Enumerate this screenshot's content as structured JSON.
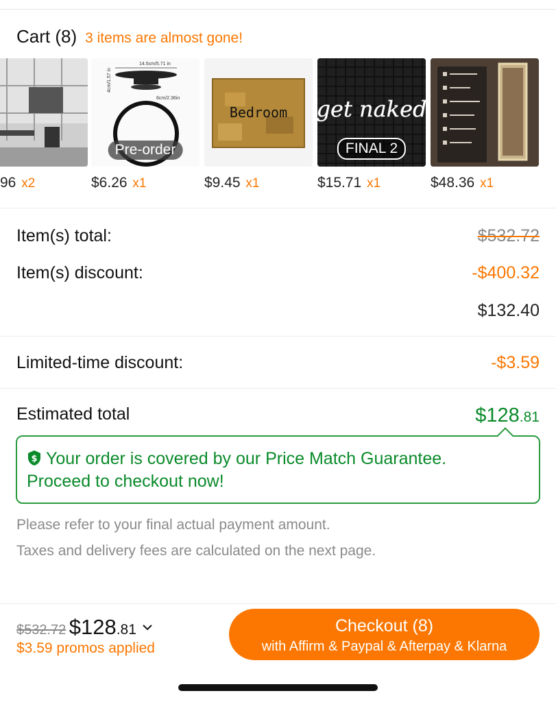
{
  "cart": {
    "title": "Cart (8)",
    "note": "3 items are almost gone!"
  },
  "items": [
    {
      "price": "96",
      "qty": "x2",
      "badge": ""
    },
    {
      "price": "$6.26",
      "qty": "x1",
      "badge": "Pre-order"
    },
    {
      "price": "$9.45",
      "qty": "x1",
      "badge": "",
      "sign_text": "Bedroom"
    },
    {
      "price": "$15.71",
      "qty": "x1",
      "badge": "FINAL 2",
      "neon_text": "get naked"
    },
    {
      "price": "$48.36",
      "qty": "x1",
      "badge": ""
    }
  ],
  "item2_dims": {
    "top": "14.5cm/5.71 in",
    "side": "4cm/1.57 in",
    "bottom": "6cm/2.36in"
  },
  "summary": {
    "items_total_label": "Item(s) total:",
    "items_total_value": "$532.72",
    "items_discount_label": "Item(s) discount:",
    "items_discount_value": "-$400.32",
    "subtotal_value": "$132.40",
    "limited_label": "Limited-time discount:",
    "limited_value": "-$3.59",
    "estimated_label": "Estimated total",
    "estimated_dollars": "$128",
    "estimated_cents": ".81"
  },
  "guarantee": {
    "line1": "Your order is covered by our Price Match Guarantee.",
    "line2": "Proceed to checkout now!"
  },
  "notes": {
    "line1": "Please refer to your final actual payment amount.",
    "line2": "Taxes and delivery fees are calculated on the next page."
  },
  "bottom_bar": {
    "old_price": "$532.72",
    "new_dollars": "$128",
    "new_cents": ".81",
    "promos": "$3.59 promos applied",
    "checkout_label": "Checkout (8)",
    "checkout_sub": "with Affirm & Paypal & Afterpay & Klarna"
  },
  "colors": {
    "accent": "#fb7701",
    "green": "#0a8a2a"
  }
}
